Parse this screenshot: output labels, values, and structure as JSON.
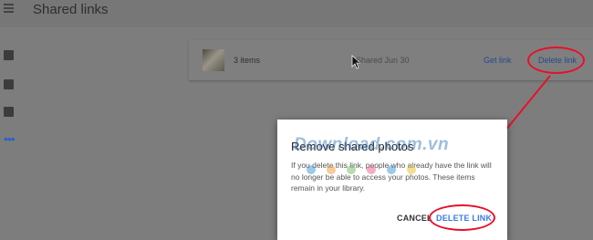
{
  "header": {
    "title": "Shared links"
  },
  "sidebar": {
    "more_label": "•••"
  },
  "shared_item": {
    "count": "3 items",
    "date": "Shared Jun 30",
    "get_link_label": "Get link",
    "delete_link_label": "Delete link"
  },
  "dialog": {
    "title": "Remove shared photos",
    "body": "If you delete this link, people who already have the link will no longer be able to access your photos. These items remain in your library.",
    "cancel_label": "CANCEL",
    "delete_label": "DELETE LINK"
  },
  "watermark": {
    "text": "Download.com.vn"
  },
  "colors": {
    "annotation": "#e8102a",
    "accent": "#3b78e7",
    "watermark_dots": [
      "#4a9fd6",
      "#f0a04b",
      "#7cc36a",
      "#e86b8f",
      "#4a9fd6",
      "#e8c33b"
    ]
  }
}
